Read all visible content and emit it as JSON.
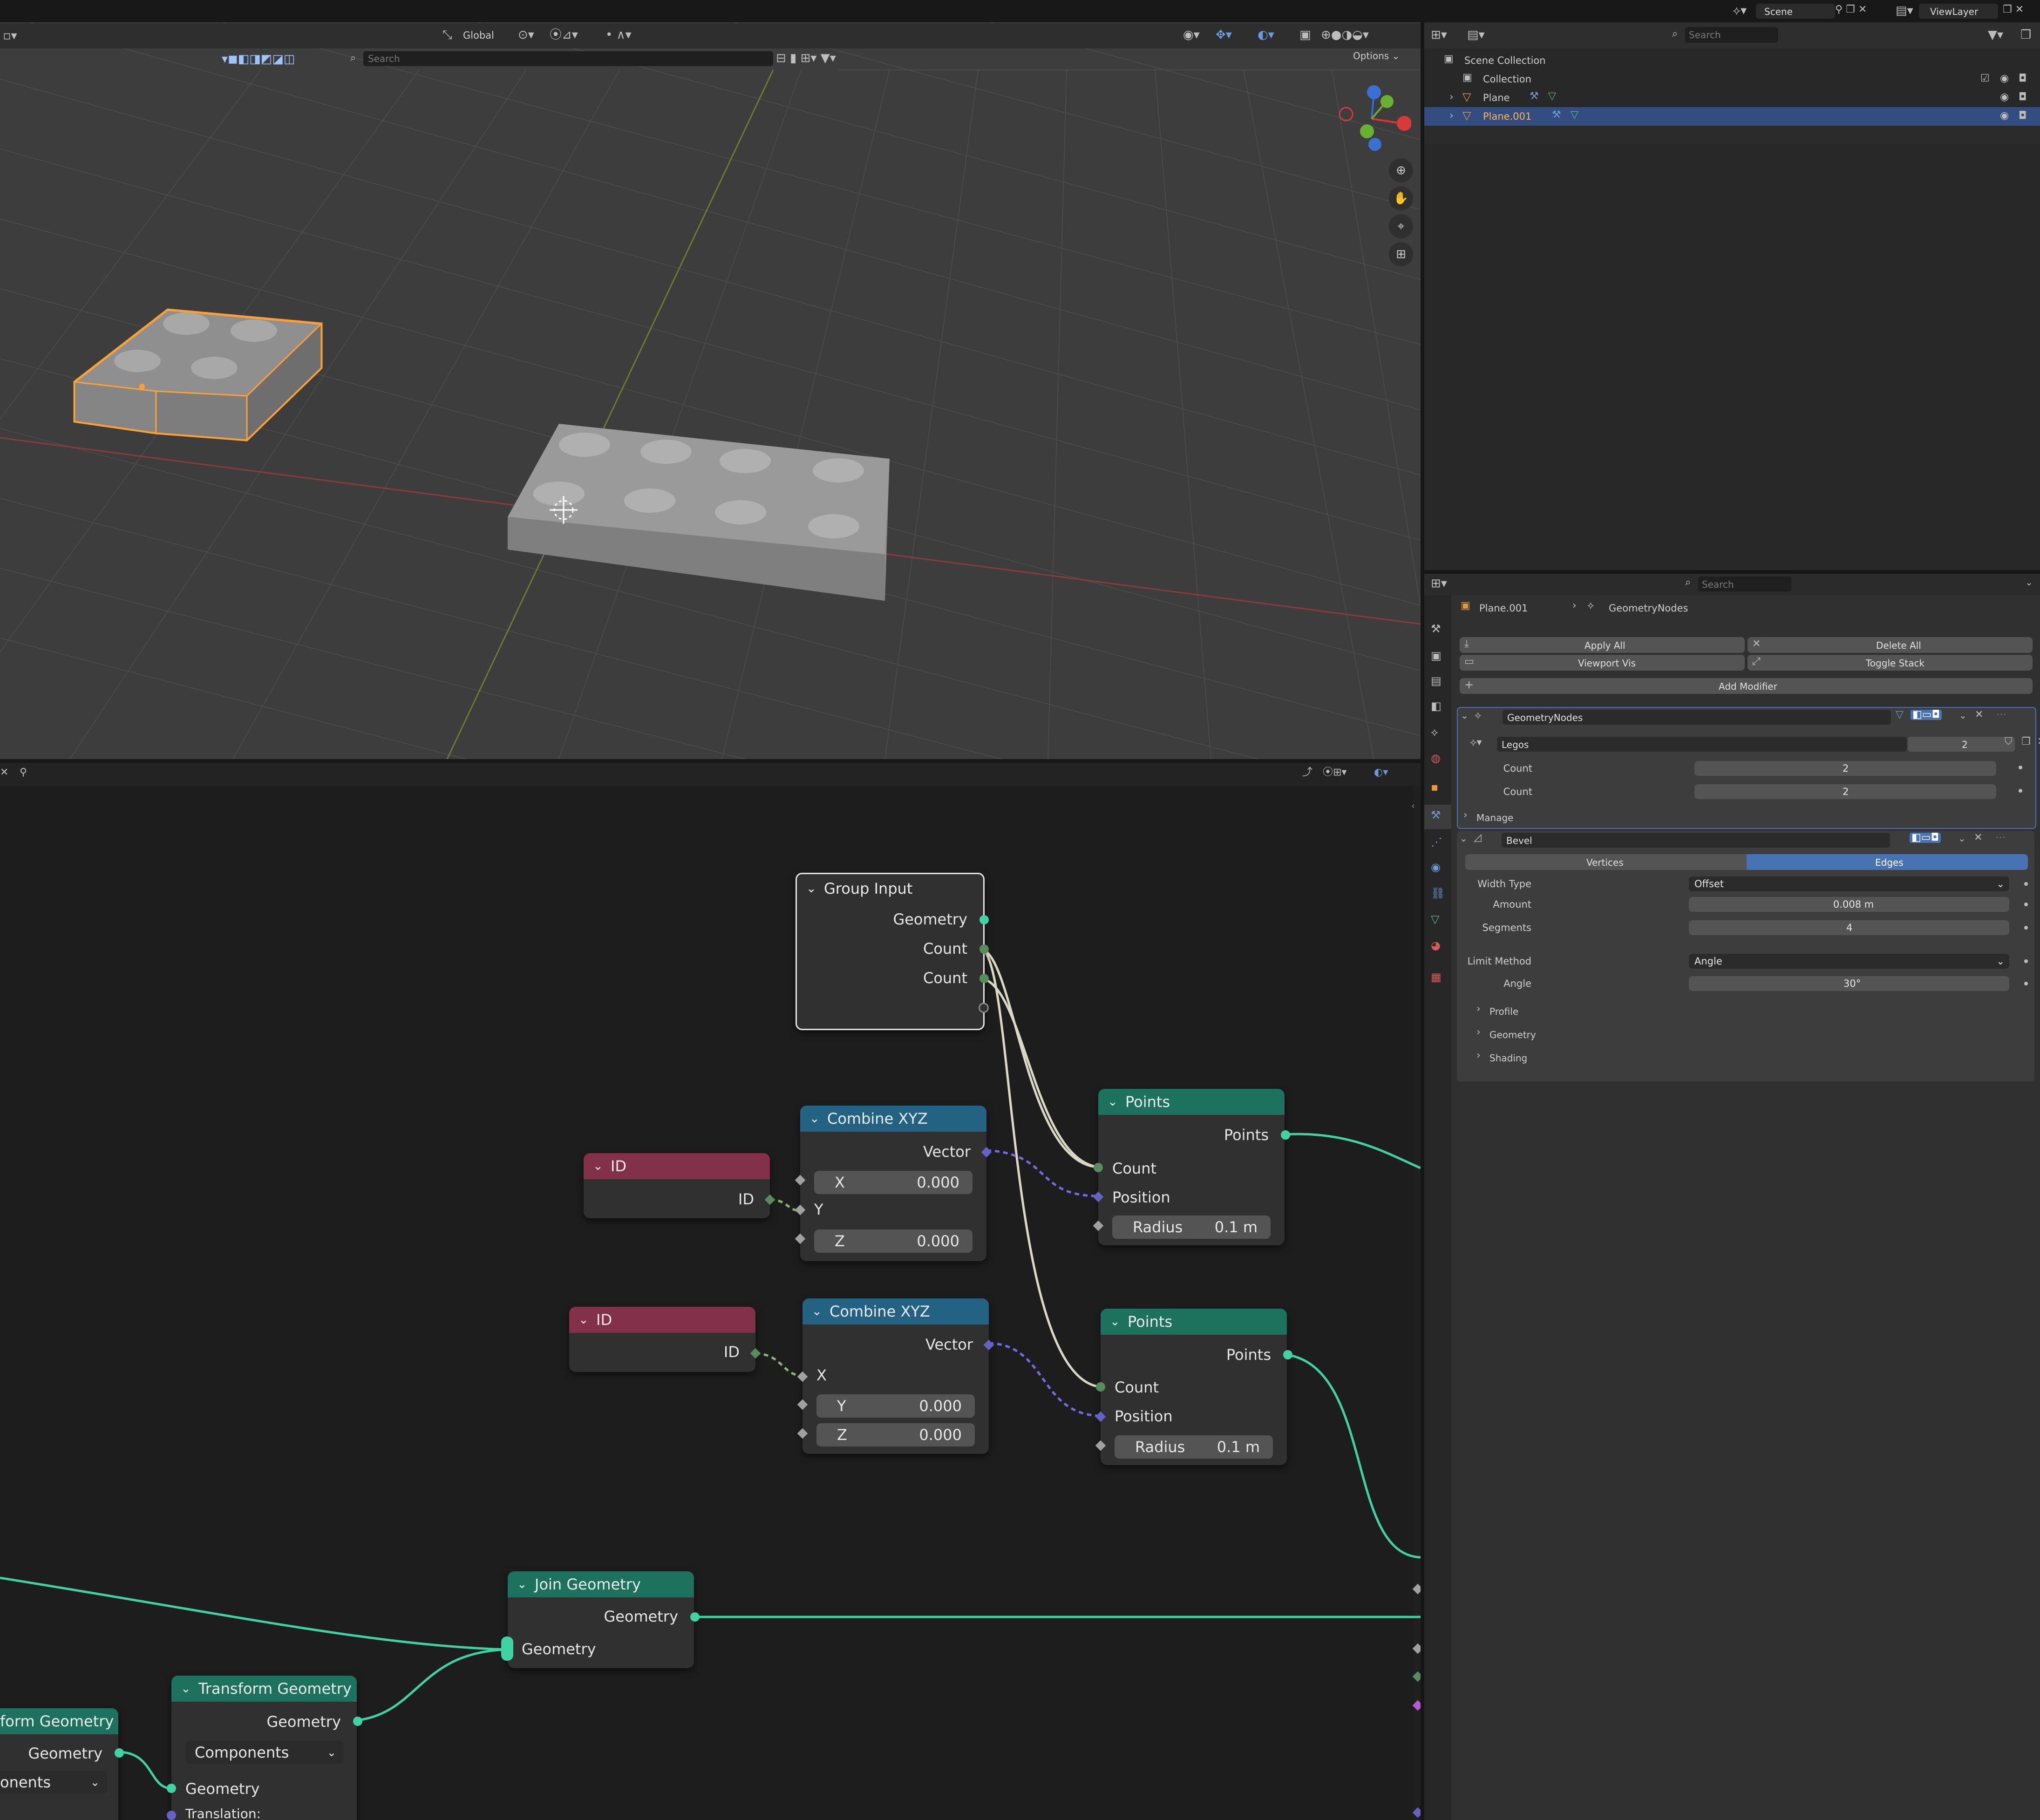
{
  "viewport": {
    "orientation": "Global",
    "search_placeholder": "Search",
    "options_label": "Options"
  },
  "topbar": {
    "scene": "Scene",
    "view_layer": "ViewLayer"
  },
  "outliner": {
    "search_placeholder": "Search",
    "root": "Scene Collection",
    "items": [
      {
        "label": "Collection"
      },
      {
        "label": "Plane"
      },
      {
        "label": "Plane.001"
      }
    ]
  },
  "properties": {
    "search_placeholder": "Search",
    "breadcrumb_object": "Plane.001",
    "breadcrumb_modifier": "GeometryNodes",
    "apply_all": "Apply All",
    "delete_all": "Delete All",
    "viewport_vis": "Viewport Vis",
    "toggle_stack": "Toggle Stack",
    "add_modifier": "Add Modifier",
    "geonodes": {
      "name": "GeometryNodes",
      "node_group": "Legos",
      "users": "2",
      "inputs": [
        {
          "label": "Count",
          "value": "2"
        },
        {
          "label": "Count",
          "value": "2"
        }
      ],
      "manage": "Manage"
    },
    "bevel": {
      "name": "Bevel",
      "tab_vertices": "Vertices",
      "tab_edges": "Edges",
      "width_type_label": "Width Type",
      "width_type": "Offset",
      "amount_label": "Amount",
      "amount": "0.008 m",
      "segments_label": "Segments",
      "segments": "4",
      "limit_method_label": "Limit Method",
      "limit_method": "Angle",
      "angle_label": "Angle",
      "angle": "30°",
      "sections": [
        "Profile",
        "Geometry",
        "Shading"
      ]
    }
  },
  "nodes": {
    "group_input": {
      "title": "Group Input",
      "outputs": [
        "Geometry",
        "Count",
        "Count"
      ]
    },
    "id1": {
      "title": "ID",
      "output": "ID"
    },
    "id2": {
      "title": "ID",
      "output": "ID"
    },
    "combine1": {
      "title": "Combine XYZ",
      "output": "Vector",
      "x_label": "X",
      "x": "0.000",
      "y_label": "Y",
      "z_label": "Z",
      "z": "0.000"
    },
    "combine2": {
      "title": "Combine XYZ",
      "output": "Vector",
      "x_label": "X",
      "y_label": "Y",
      "y": "0.000",
      "z_label": "Z",
      "z": "0.000"
    },
    "points1": {
      "title": "Points",
      "output": "Points",
      "count": "Count",
      "position": "Position",
      "radius_label": "Radius",
      "radius": "0.1 m"
    },
    "points2": {
      "title": "Points",
      "output": "Points",
      "count": "Count",
      "position": "Position",
      "radius_label": "Radius",
      "radius": "0.1 m"
    },
    "join": {
      "title": "Join Geometry",
      "output": "Geometry",
      "input": "Geometry"
    },
    "transform": {
      "title": "Transform Geometry",
      "output": "Geometry",
      "mode": "Components",
      "input": "Geometry",
      "translation": "Translation:"
    },
    "transform_left": {
      "title": "form Geometry",
      "output": "Geometry",
      "mode": "onents"
    }
  },
  "colors": {
    "accent": "#4772b3",
    "geometry_socket": "#00d6a3",
    "vector_socket": "#6363c7",
    "int_socket": "#598c5c",
    "selection_orange": "#ffa033",
    "header_input": "#83314a",
    "header_converter": "#246283",
    "header_geometry": "#1d725e"
  }
}
